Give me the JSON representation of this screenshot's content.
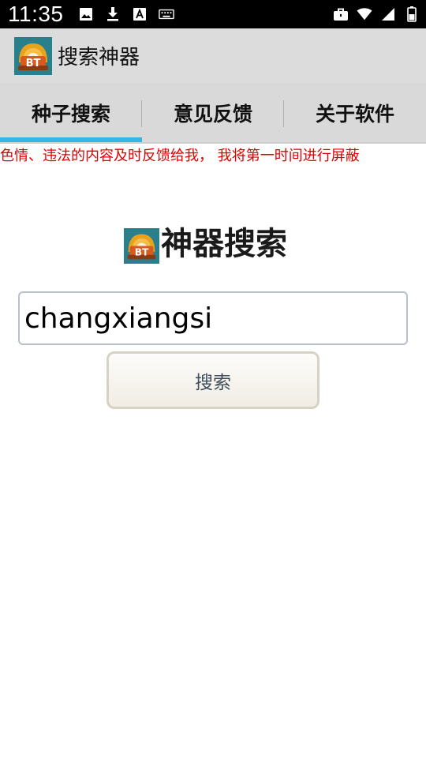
{
  "status_bar": {
    "time": "11:35",
    "left_icons": [
      "image-icon",
      "download-icon",
      "text-a-icon",
      "keyboard-icon"
    ],
    "right_icons": [
      "briefcase-icon",
      "wifi-icon",
      "signal-icon",
      "battery-icon"
    ]
  },
  "app_bar": {
    "title": "搜索神器",
    "logo_text": "BT"
  },
  "tabs": [
    {
      "label": "种子搜索",
      "active": true
    },
    {
      "label": "意见反馈",
      "active": false
    },
    {
      "label": "关于软件",
      "active": false
    }
  ],
  "notice": {
    "text": "、色情、违法的内容及时反馈给我， 我将第一时间进行屏蔽"
  },
  "main": {
    "heading": "神器搜索",
    "logo_text": "BT",
    "search_value": "changxiangsi",
    "search_button_label": "搜索"
  },
  "colors": {
    "accent": "#33b5e5",
    "notice": "#e00000",
    "app_bar_bg": "#dcdcdc"
  }
}
